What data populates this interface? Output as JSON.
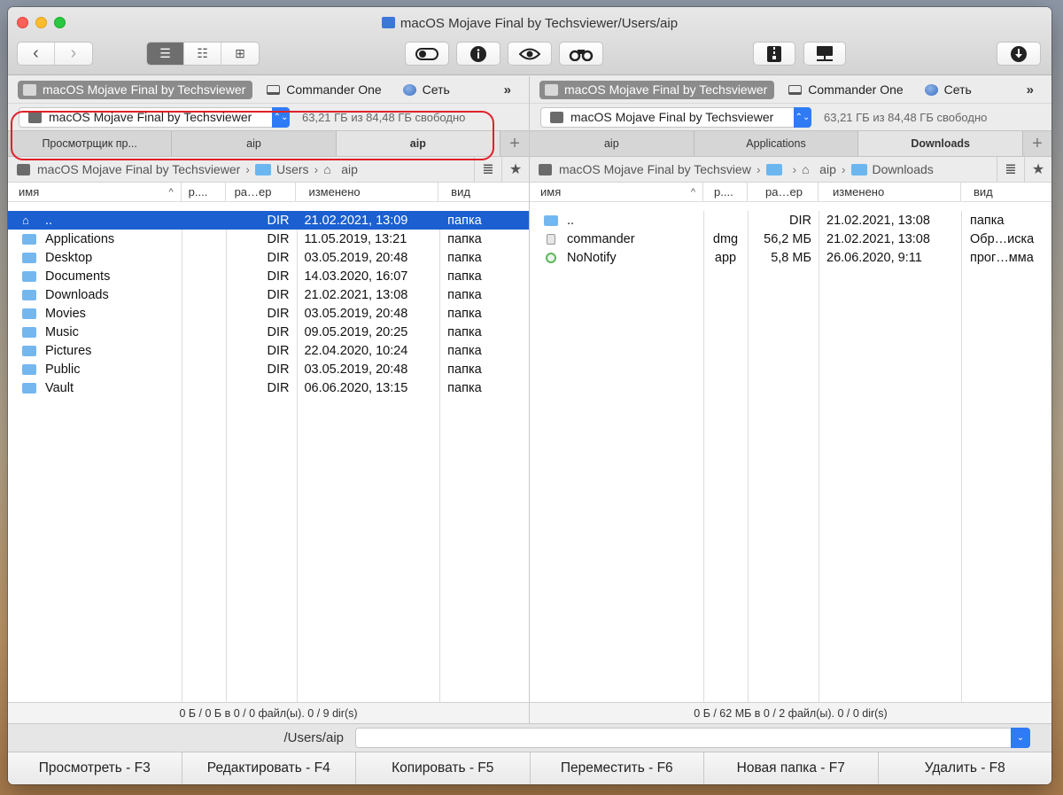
{
  "window": {
    "title": "macOS Mojave Final by Techsviewer/Users/aip"
  },
  "toolbar": {
    "back": "‹",
    "forward": "›"
  },
  "left": {
    "drives": [
      "macOS Mojave Final by Techsviewer",
      "Commander One",
      "Сеть"
    ],
    "more": "»",
    "volume": "macOS Mojave Final by Techsviewer",
    "free": "63,21 ГБ из 84,48 ГБ свободно",
    "tabs": [
      "Просмотрщик пр...",
      "aip",
      "aip"
    ],
    "path": [
      "macOS Mojave Final by Techsviewer",
      "Users",
      "aip"
    ],
    "columns": {
      "name": "имя",
      "ext": "р....",
      "size": "ра…ер",
      "date": "изменено",
      "kind": "вид"
    },
    "rows": [
      {
        "name": "..",
        "ext": "",
        "size": "DIR",
        "date": "21.02.2021, 13:09",
        "kind": "папка"
      },
      {
        "name": "Applications",
        "ext": "",
        "size": "DIR",
        "date": "11.05.2019, 13:21",
        "kind": "папка"
      },
      {
        "name": "Desktop",
        "ext": "",
        "size": "DIR",
        "date": "03.05.2019, 20:48",
        "kind": "папка"
      },
      {
        "name": "Documents",
        "ext": "",
        "size": "DIR",
        "date": "14.03.2020, 16:07",
        "kind": "папка"
      },
      {
        "name": "Downloads",
        "ext": "",
        "size": "DIR",
        "date": "21.02.2021, 13:08",
        "kind": "папка"
      },
      {
        "name": "Movies",
        "ext": "",
        "size": "DIR",
        "date": "03.05.2019, 20:48",
        "kind": "папка"
      },
      {
        "name": "Music",
        "ext": "",
        "size": "DIR",
        "date": "09.05.2019, 20:25",
        "kind": "папка"
      },
      {
        "name": "Pictures",
        "ext": "",
        "size": "DIR",
        "date": "22.04.2020, 10:24",
        "kind": "папка"
      },
      {
        "name": "Public",
        "ext": "",
        "size": "DIR",
        "date": "03.05.2019, 20:48",
        "kind": "папка"
      },
      {
        "name": "Vault",
        "ext": "",
        "size": "DIR",
        "date": "06.06.2020, 13:15",
        "kind": "папка"
      }
    ],
    "status": "0 Б / 0 Б в 0 / 0 файл(ы). 0 / 9 dir(s)"
  },
  "right": {
    "drives": [
      "macOS Mojave Final by Techsviewer",
      "Commander One",
      "Сеть"
    ],
    "more": "»",
    "volume": "macOS Mojave Final by Techsviewer",
    "free": "63,21 ГБ из 84,48 ГБ свободно",
    "tabs": [
      "aip",
      "Applications",
      "Downloads"
    ],
    "path": [
      "macOS Mojave Final by Techsview",
      "",
      "aip",
      "Downloads"
    ],
    "columns": {
      "name": "имя",
      "ext": "р....",
      "size": "ра…ер",
      "date": "изменено",
      "kind": "вид"
    },
    "rows": [
      {
        "name": "..",
        "ext": "",
        "size": "DIR",
        "date": "21.02.2021, 13:08",
        "kind": "папка"
      },
      {
        "name": "commander",
        "ext": "dmg",
        "size": "56,2 МБ",
        "date": "21.02.2021, 13:08",
        "kind": "Обр…иска"
      },
      {
        "name": "NoNotify",
        "ext": "app",
        "size": "5,8 МБ",
        "date": "26.06.2020, 9:11",
        "kind": "прог…мма"
      }
    ],
    "status": "0 Б / 62 МБ в 0 / 2 файл(ы). 0 / 0 dir(s)"
  },
  "command": {
    "path": "/Users/aip",
    "value": ""
  },
  "fkeys": [
    "Просмотреть - F3",
    "Редактировать - F4",
    "Копировать - F5",
    "Переместить - F6",
    "Новая папка - F7",
    "Удалить - F8"
  ]
}
